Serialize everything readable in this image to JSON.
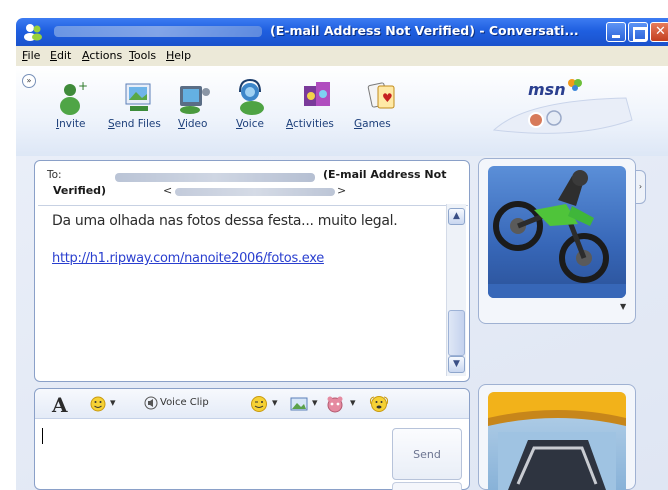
{
  "window": {
    "title": "(E-mail Address Not Verified) - Conversati..."
  },
  "menu": {
    "file": "File",
    "edit": "Edit",
    "actions": "Actions",
    "tools": "Tools",
    "help": "Help"
  },
  "toolbar": {
    "invite": "Invite",
    "send_files": "Send Files",
    "video": "Video",
    "voice": "Voice",
    "activities": "Activities",
    "games": "Games",
    "brand": "msn"
  },
  "conversation": {
    "to_label": "To:",
    "to_unverified_1": "(E-mail Address Not",
    "to_unverified_2": "Verified)",
    "to_lt": "<",
    "to_gt": ">",
    "message": "Da uma olhada nas fotos dessa festa... muito legal.",
    "link": "http://h1.ripway.com/nanoite2006/fotos.exe"
  },
  "compose": {
    "voice_clip": "Voice Clip",
    "send": "Send"
  },
  "colors": {
    "titlebar": "#1f5fe0",
    "link": "#2a3fcf",
    "frame_border": "#8aa0c8"
  }
}
